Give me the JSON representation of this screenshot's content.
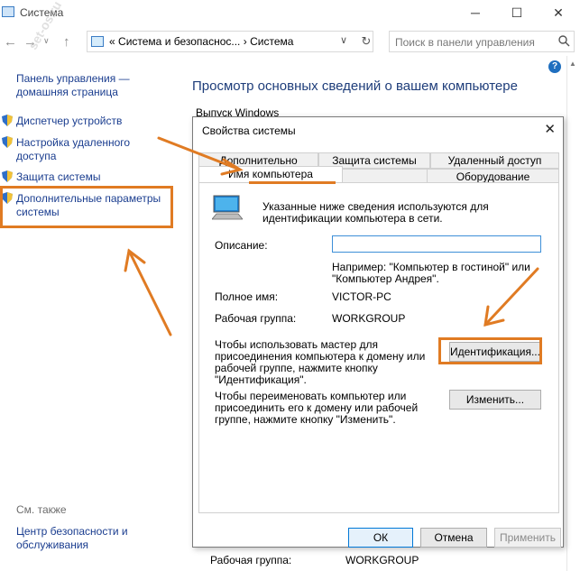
{
  "window": {
    "title": "Система",
    "breadcrumb_prefix": "«",
    "breadcrumb_1": "Система и безопаснос...",
    "breadcrumb_sep": "›",
    "breadcrumb_2": "Система",
    "search_placeholder": "Поиск в панели управления"
  },
  "sidebar": {
    "home_link_line1": "Панель управления —",
    "home_link_line2": "домашняя страница",
    "items": [
      {
        "label_line1": "Диспетчер устройств",
        "label_line2": ""
      },
      {
        "label_line1": "Настройка удаленного",
        "label_line2": "доступа"
      },
      {
        "label_line1": "Защита системы",
        "label_line2": ""
      },
      {
        "label_line1": "Дополнительные параметры",
        "label_line2": "системы"
      }
    ],
    "see_also": "См. также",
    "security_line1": "Центр безопасности и",
    "security_line2": "обслуживания"
  },
  "main": {
    "title": "Просмотр основных сведений о вашем компьютере",
    "edition_partial": "Выпуск Windows",
    "bottom_label": "Рабочая группа:",
    "bottom_value": "WORKGROUP"
  },
  "dialog": {
    "title": "Свойства системы",
    "tabs_row1": [
      "Дополнительно",
      "Защита системы",
      "Удаленный доступ"
    ],
    "tabs_row2": [
      "Имя компьютера",
      "Оборудование"
    ],
    "info_line1": "Указанные ниже сведения используются для",
    "info_line2": "идентификации компьютера в сети.",
    "description_label": "Описание:",
    "description_value": "",
    "example_line1": "Например: \"Компьютер в гостиной\" или",
    "example_line2": "\"Компьютер Андрея\".",
    "fullname_label": "Полное имя:",
    "fullname_value": "VICTOR-PC",
    "workgroup_label": "Рабочая группа:",
    "workgroup_value": "WORKGROUP",
    "wizard_line1": "Чтобы использовать мастер для",
    "wizard_line2": "присоединения компьютера к домену или",
    "wizard_line3": "рабочей группе, нажмите кнопку",
    "wizard_line4": "\"Идентификация\".",
    "identify_button": "Идентификация...",
    "rename_line1": "Чтобы переименовать компьютер или",
    "rename_line2": "присоединить его к домену или рабочей",
    "rename_line3": "группе, нажмите кнопку \"Изменить\".",
    "change_button": "Изменить...",
    "ok_button": "ОК",
    "cancel_button": "Отмена",
    "apply_button": "Применить"
  },
  "colors": {
    "highlight": "#e07b23",
    "link": "#1a3d8f",
    "title_blue": "#1e3d7a"
  }
}
